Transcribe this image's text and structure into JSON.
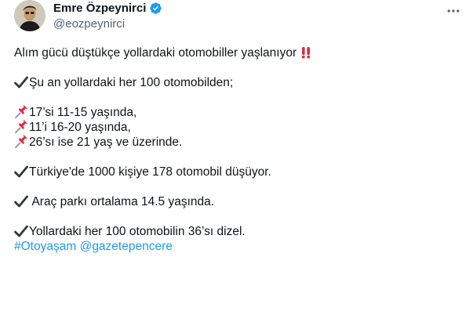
{
  "author": {
    "name": "Emre Özpeynirci",
    "handle": "@eozpeynirci",
    "verified": true,
    "verified_color": "#1d9bf0"
  },
  "icons": {
    "verified": "verified-badge-icon",
    "more": "more-options-icon",
    "check": "heavy-check-mark",
    "pin": "pushpin",
    "alert": "double-exclamation-mark"
  },
  "tweet": {
    "intro": "Alım gücü düştükçe yollardaki otomobiller yaşlanıyor",
    "line_now": "Şu an yollardaki her 100 otomobilden;",
    "age_11_15": "17’si 11-15 yaşında,",
    "age_16_20": "11’i 16-20 yaşında,",
    "age_21_plus": "26’sı ise 21 yaş ve üzerinde.",
    "per_1000": "Türkiye'de 1000 kişiye 178 otomobil düşüyor.",
    "avg_age": " Araç parkı ortalama 14.5 yaşında.",
    "diesel": "Yollardaki her 100 otomobilin 36’sı dizel.",
    "hashtag": "#Otoyaşam",
    "mention": "@gazetepencere",
    "link_color": "#1d9bf0"
  }
}
